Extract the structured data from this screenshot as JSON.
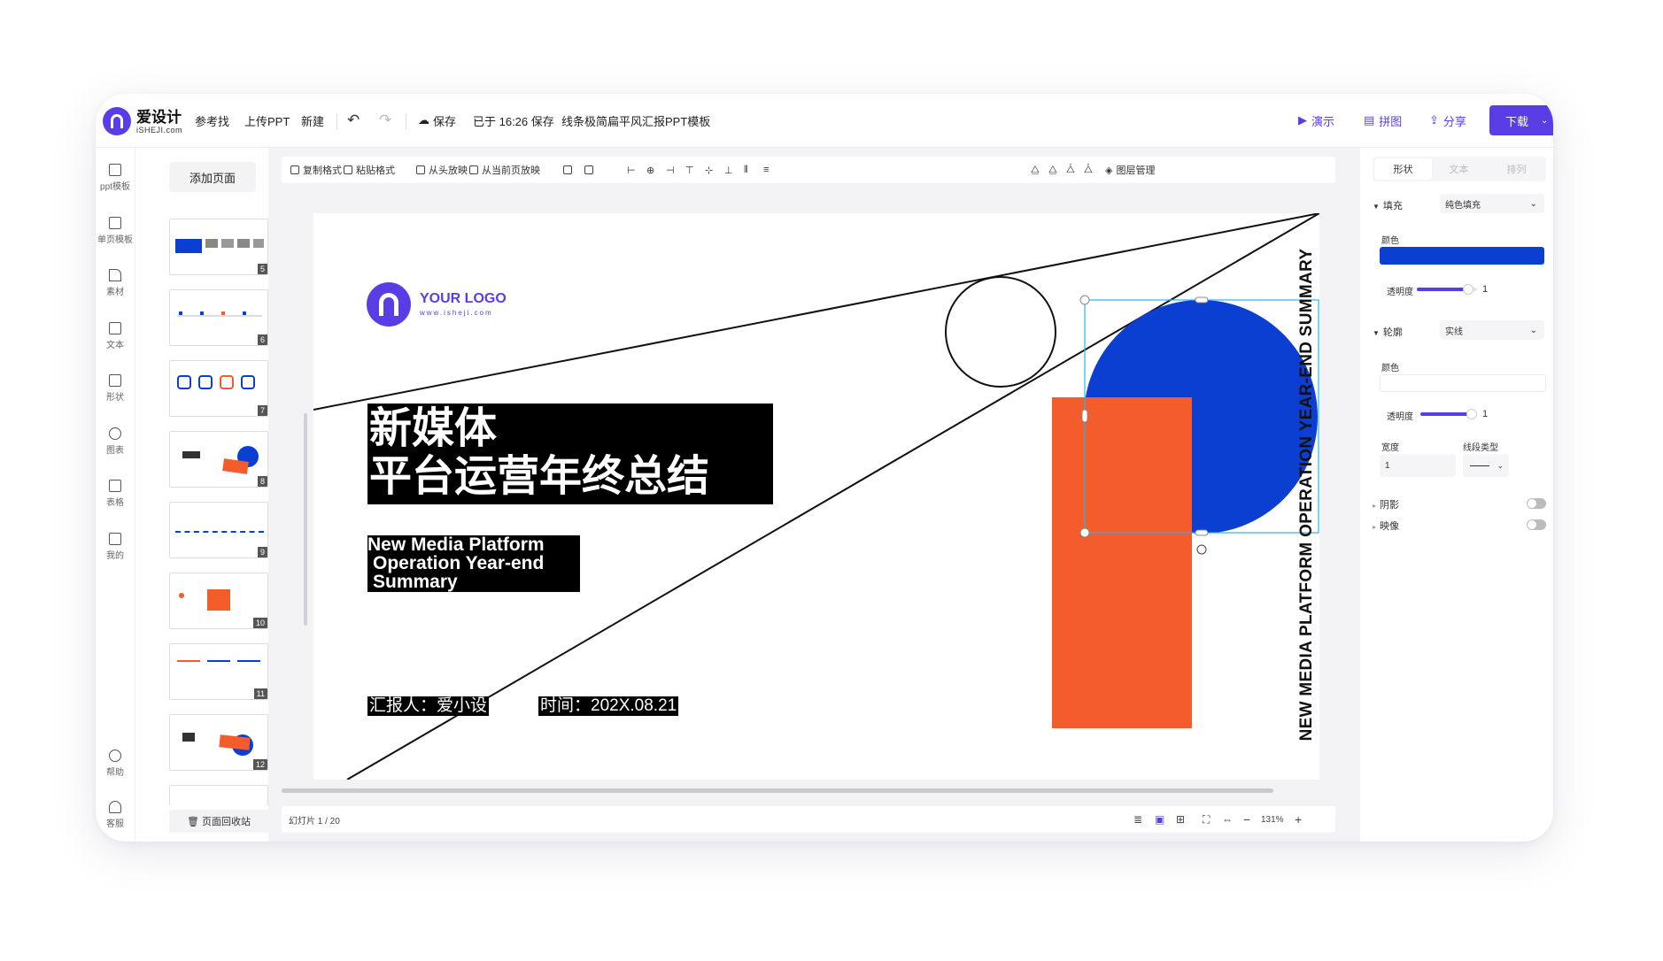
{
  "app": {
    "logo_cn": "爱设计",
    "logo_en": "iSHEJI.com"
  },
  "topbar": {
    "reference": "参考找",
    "upload": "上传PPT",
    "new": "新建",
    "save": "保存",
    "saved_status": "已于 16:26 保存",
    "doc_title": "线条极简扁平风汇报PPT模板",
    "present": "演示",
    "collage": "拼图",
    "share": "分享",
    "download": "下载"
  },
  "leftnav": [
    {
      "label": "ppt模板",
      "icon": "template-icon"
    },
    {
      "label": "单页模板",
      "icon": "page-template-icon"
    },
    {
      "label": "素材",
      "icon": "material-icon"
    },
    {
      "label": "文本",
      "icon": "text-icon"
    },
    {
      "label": "形状",
      "icon": "shape-icon"
    },
    {
      "label": "图表",
      "icon": "chart-icon"
    },
    {
      "label": "表格",
      "icon": "table-icon"
    },
    {
      "label": "我的",
      "icon": "upload-icon"
    },
    {
      "label": "帮助",
      "icon": "help-icon"
    },
    {
      "label": "客服",
      "icon": "headset-icon"
    }
  ],
  "thumbs_panel": {
    "add_page": "添加页面",
    "recycle": "页面回收站",
    "pages": [
      "5",
      "6",
      "7",
      "8",
      "9",
      "10",
      "11",
      "12"
    ]
  },
  "toolbar": {
    "copy_format": "复制格式",
    "paste_format": "粘贴格式",
    "play_from_start": "从头放映",
    "play_from_current": "从当前页放映",
    "layer_manager": "图层管理"
  },
  "slide": {
    "logo_text": "YOUR LOGO",
    "logo_url": "www.isheji.com",
    "title_line1": "新媒体",
    "title_line2": "平台运营年终总结",
    "subtitle_line1": "New Media Platform",
    "subtitle_line2": "Operation Year-end",
    "subtitle_line3": "Summary",
    "reporter": "汇报人：爱小设",
    "date": "时间：202X.08.21",
    "vertical_text": "NEW MEDIA PLATFORM OPERATION YEAR-END SUMMARY",
    "colors": {
      "blue": "#0b3fd1",
      "orange": "#f45c2c",
      "purple": "#5b3de6"
    }
  },
  "statusbar": {
    "slide_count": "幻灯片 1 / 20",
    "zoom": "131%"
  },
  "rpanel": {
    "tabs": [
      "形状",
      "文本",
      "排列"
    ],
    "fill_section": "填充",
    "fill_type": "纯色填充",
    "color_label": "颜色",
    "fill_color": "#0b3fd1",
    "opacity_label": "透明度",
    "opacity_value": "1",
    "opacity_fill": 0.85,
    "outline_section": "轮廓",
    "outline_type": "实线",
    "outline_color_label": "颜色",
    "outline_opacity_label": "透明度",
    "outline_opacity_value": "1",
    "width_label": "宽度",
    "width_value": "1",
    "line_type_label": "线段类型",
    "shadow": "阴影",
    "reflection": "映像"
  }
}
